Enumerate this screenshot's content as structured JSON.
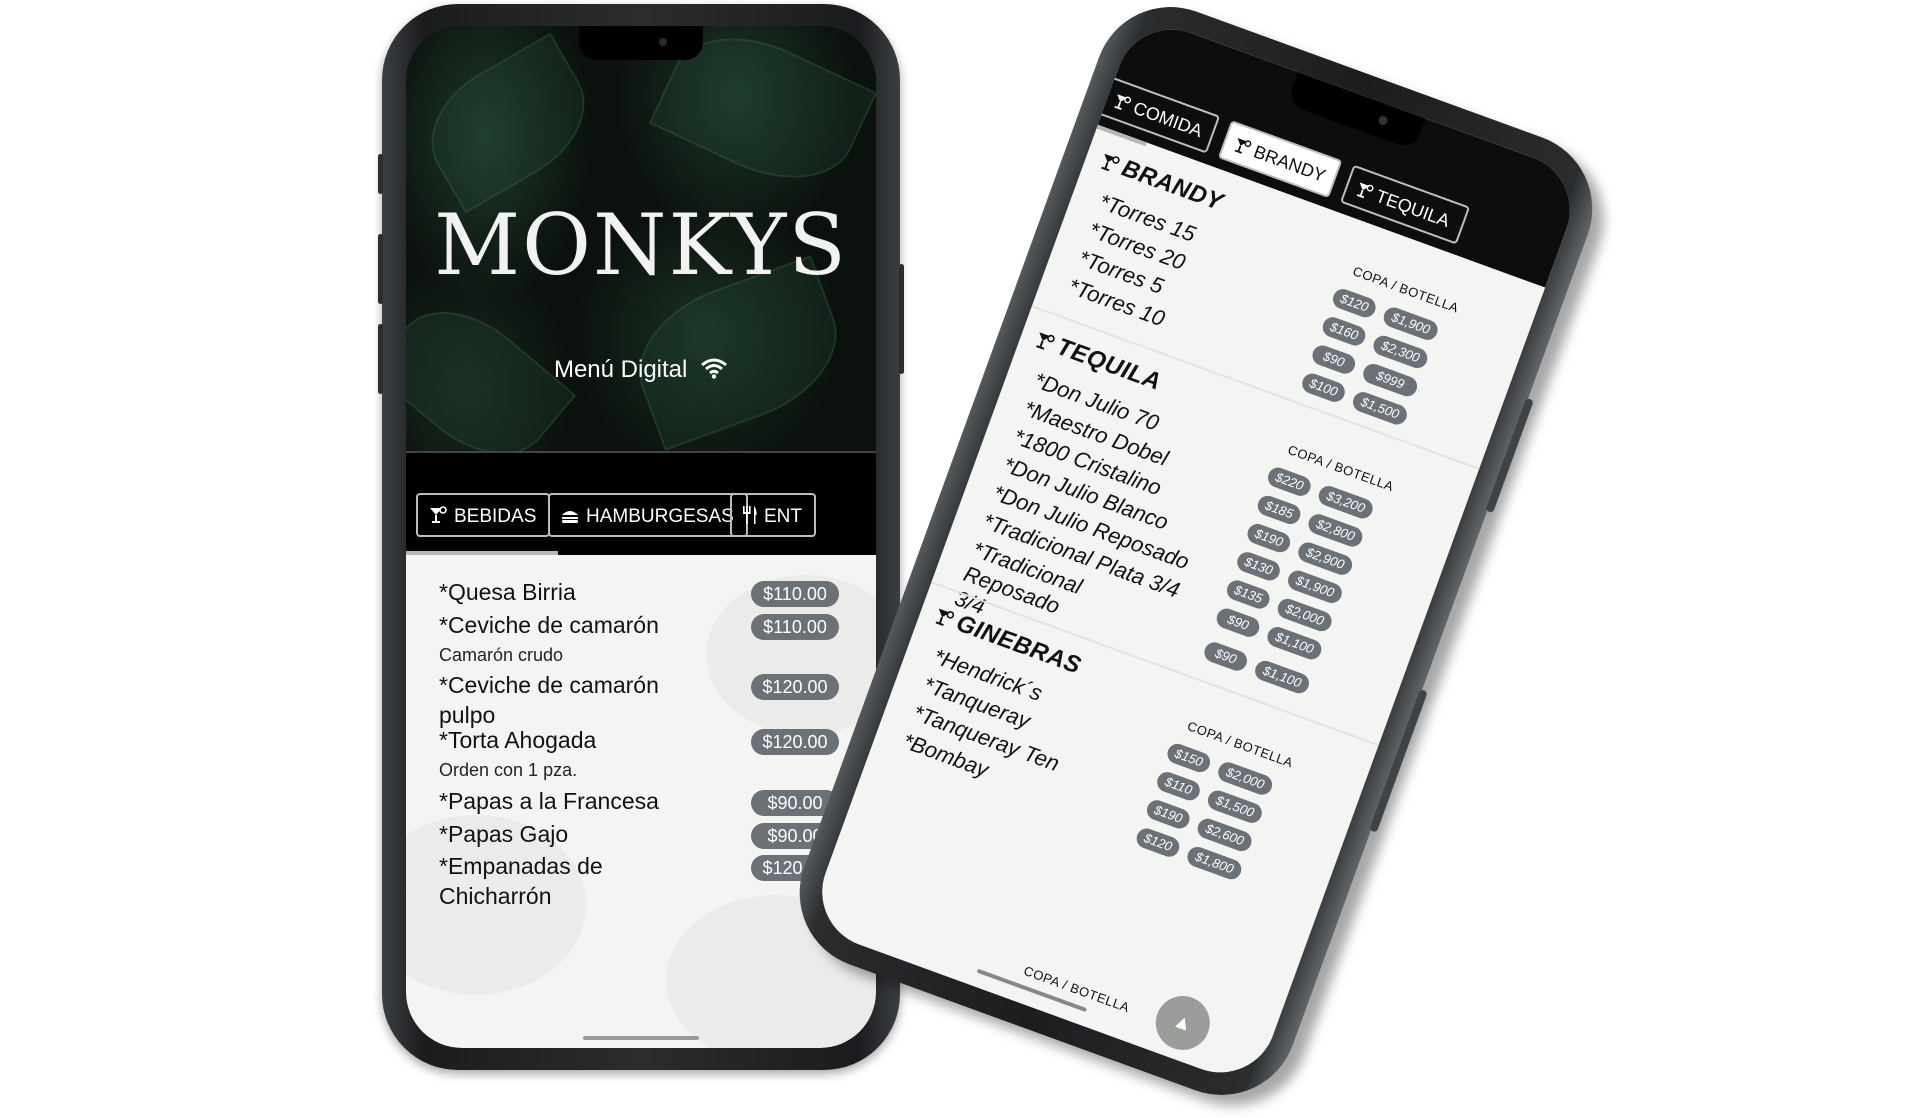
{
  "phone_left": {
    "brand": "MONKYS",
    "subtitle": "Menú Digital",
    "tabs": [
      {
        "label": "BEBIDAS",
        "icon": "cocktail-icon"
      },
      {
        "label": "HAMBURGESAS",
        "icon": "burger-icon"
      },
      {
        "label": "ENT",
        "icon": "utensils-icon"
      }
    ],
    "items": [
      {
        "name": "*Quesa Birria",
        "price": "$110.00",
        "desc": ""
      },
      {
        "name": "*Ceviche de camarón",
        "price": "$110.00",
        "desc": "Camarón crudo"
      },
      {
        "name": "*Ceviche de camarón pulpo",
        "price": "$120.00",
        "desc": ""
      },
      {
        "name": "*Torta Ahogada",
        "price": "$120.00",
        "desc": "Orden con 1 pza."
      },
      {
        "name": "*Papas a la Francesa",
        "price": "$90.00",
        "desc": ""
      },
      {
        "name": "*Papas Gajo",
        "price": "$90.00",
        "desc": ""
      },
      {
        "name": "*Empanadas de Chicharrón",
        "price": "$120.00",
        "desc": ""
      }
    ]
  },
  "phone_right": {
    "tabs": [
      {
        "label": "COMIDA",
        "active": false
      },
      {
        "label": "BRANDY",
        "active": true
      },
      {
        "label": "TEQUILA",
        "active": false
      }
    ],
    "sections": [
      {
        "title": "BRANDY",
        "columns": "COPA / BOTELLA",
        "items": [
          {
            "name": "*Torres 15",
            "copa": "$120",
            "botella": "$1,900"
          },
          {
            "name": "*Torres 20",
            "copa": "$160",
            "botella": "$2,300"
          },
          {
            "name": "*Torres 5",
            "copa": "$90",
            "botella": "$999"
          },
          {
            "name": "*Torres 10",
            "copa": "$100",
            "botella": "$1,500"
          }
        ]
      },
      {
        "title": "TEQUILA",
        "columns": "COPA / BOTELLA",
        "items": [
          {
            "name": "*Don Julio 70",
            "copa": "$220",
            "botella": "$3,200"
          },
          {
            "name": "*Maestro Dobel",
            "copa": "$185",
            "botella": "$2,800"
          },
          {
            "name": "*1800 Cristalino",
            "copa": "$190",
            "botella": "$2,900"
          },
          {
            "name": "*Don Julio Blanco",
            "copa": "$130",
            "botella": "$1,900"
          },
          {
            "name": "*Don Julio Reposado",
            "copa": "$135",
            "botella": "$2,000"
          },
          {
            "name": "*Tradicional Plata 3/4",
            "copa": "$90",
            "botella": "$1,100"
          },
          {
            "name": "*Tradicional Reposado 3/4",
            "copa": "$90",
            "botella": "$1,100"
          }
        ]
      },
      {
        "title": "GINEBRAS",
        "columns": "COPA / BOTELLA",
        "items": [
          {
            "name": "*Hendrick´s",
            "copa": "$150",
            "botella": "$2,000"
          },
          {
            "name": "*Tanqueray",
            "copa": "$110",
            "botella": "$1,500"
          },
          {
            "name": "*Tanqueray Ten",
            "copa": "$190",
            "botella": "$2,600"
          },
          {
            "name": "*Bombay",
            "copa": "$120",
            "botella": "$1,800"
          }
        ]
      }
    ],
    "footer_columns": "COPA / BOTELLA",
    "scroll_top_icon": "arrow-up-icon"
  }
}
